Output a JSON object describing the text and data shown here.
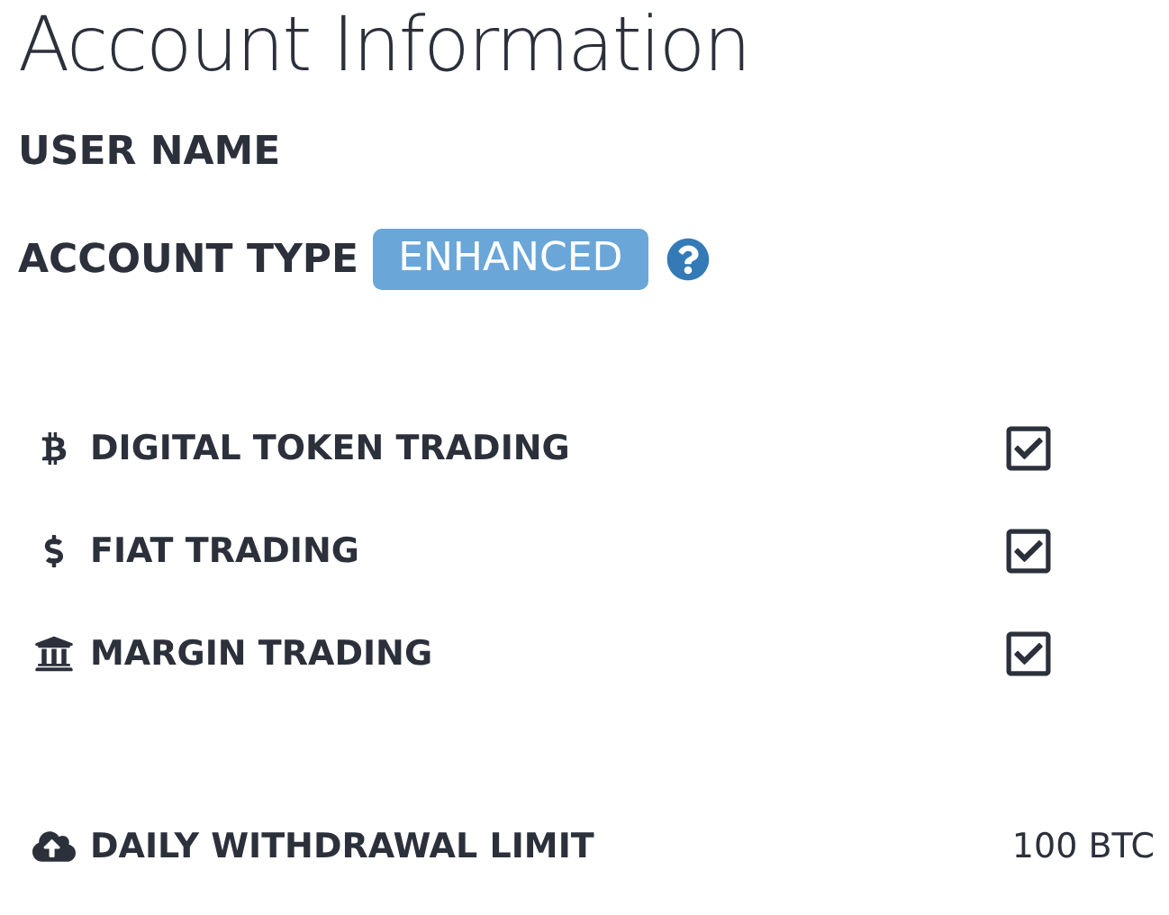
{
  "title": "Account Information",
  "user_name": {
    "label": "USER NAME"
  },
  "account_type": {
    "label": "ACCOUNT TYPE",
    "badge": "ENHANCED"
  },
  "permissions": [
    {
      "label": "DIGITAL TOKEN TRADING",
      "checked": true
    },
    {
      "label": "FIAT TRADING",
      "checked": true
    },
    {
      "label": "MARGIN TRADING",
      "checked": true
    }
  ],
  "withdrawal": {
    "label": "DAILY WITHDRAWAL LIMIT",
    "value": "100 BTC"
  }
}
